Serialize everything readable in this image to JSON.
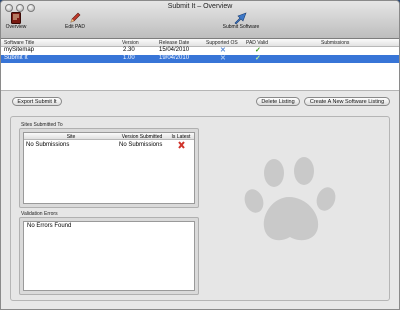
{
  "window": {
    "title": "Submit It – Overview"
  },
  "toolbar": {
    "overview_label": "Overview",
    "edit_pad_label": "Edit PAD",
    "submit_software_label": "Submit Software"
  },
  "software_list": {
    "columns": [
      "Software Title",
      "Version",
      "Release Date",
      "Supported OS",
      "PAD Valid",
      "Submissions"
    ],
    "rows": [
      {
        "title": "mySitemap",
        "version": "2.30",
        "release_date": "15/04/2010",
        "supported_os": "x-icon",
        "pad_valid": "check-icon",
        "submissions": "",
        "selected": false
      },
      {
        "title": "Submit It",
        "version": "1.00",
        "release_date": "19/04/2010",
        "supported_os": "x-icon",
        "pad_valid": "check-icon",
        "submissions": "",
        "selected": true
      }
    ]
  },
  "actions": {
    "export_label": "Export Submit It",
    "delete_label": "Delete Listing",
    "create_label": "Create A New Software Listing"
  },
  "sites_submitted": {
    "group_label": "Sites Submitted To",
    "columns": [
      "Site",
      "Version Submitted",
      "Is Latest"
    ],
    "rows": [
      {
        "site": "No Submissions",
        "version_submitted": "No Submissions",
        "is_latest": "red-x-icon"
      }
    ]
  },
  "validation": {
    "group_label": "Validation Errors",
    "text": "No Errors Found"
  },
  "colors": {
    "selection": "#3875d7",
    "check": "#3a9b1e",
    "cross": "#5b8bd6",
    "red_marker": "#d0332b"
  }
}
